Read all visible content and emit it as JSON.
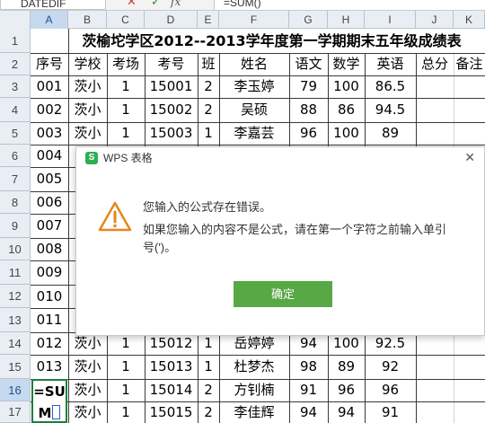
{
  "formula_bar": {
    "name_box": "DATEDIF",
    "cancel_glyph": "✕",
    "confirm_glyph": "✓",
    "fx_label": "fx",
    "formula": "=SUM()"
  },
  "columns": [
    "A",
    "B",
    "C",
    "D",
    "E",
    "F",
    "G",
    "H",
    "I",
    "J",
    "K"
  ],
  "active_column": "A",
  "active_row": "16",
  "sheet": {
    "title": "茨榆坨学区2012--2013学年度第一学期期末五年级成绩表",
    "headers": [
      "序号",
      "学校",
      "考场",
      "考号",
      "班",
      "姓名",
      "语文",
      "数学",
      "英语",
      "总分",
      "备注"
    ],
    "rows": [
      {
        "row": "3",
        "cells": [
          "001",
          "茨小",
          "1",
          "15001",
          "2",
          "李玉婷",
          "79",
          "100",
          "86.5",
          "",
          ""
        ]
      },
      {
        "row": "4",
        "cells": [
          "002",
          "茨小",
          "1",
          "15002",
          "2",
          "吴硕",
          "88",
          "86",
          "94.5",
          "",
          ""
        ]
      },
      {
        "row": "5",
        "cells": [
          "003",
          "茨小",
          "1",
          "15003",
          "1",
          "李嘉芸",
          "96",
          "100",
          "89",
          "",
          ""
        ]
      },
      {
        "row": "6",
        "cells": [
          "004",
          "",
          "",
          "",
          "",
          "",
          "",
          "",
          "",
          "",
          ""
        ]
      },
      {
        "row": "7",
        "cells": [
          "005",
          "",
          "",
          "",
          "",
          "",
          "",
          "",
          "",
          "",
          ""
        ]
      },
      {
        "row": "8",
        "cells": [
          "006",
          "",
          "",
          "",
          "",
          "",
          "",
          "",
          "",
          "",
          ""
        ]
      },
      {
        "row": "9",
        "cells": [
          "007",
          "",
          "",
          "",
          "",
          "",
          "",
          "",
          "",
          "",
          ""
        ]
      },
      {
        "row": "10",
        "cells": [
          "008",
          "",
          "",
          "",
          "",
          "",
          "",
          "",
          "",
          "",
          ""
        ]
      },
      {
        "row": "11",
        "cells": [
          "009",
          "",
          "",
          "",
          "",
          "",
          "",
          "",
          "",
          "",
          ""
        ]
      },
      {
        "row": "12",
        "cells": [
          "010",
          "",
          "",
          "",
          "",
          "",
          "",
          "",
          "",
          "",
          ""
        ]
      },
      {
        "row": "13",
        "cells": [
          "011",
          "",
          "",
          "",
          "",
          "",
          "",
          "",
          "",
          "",
          ""
        ]
      },
      {
        "row": "14",
        "cells": [
          "012",
          "茨小",
          "1",
          "15012",
          "1",
          "岳婷婷",
          "94",
          "100",
          "92.5",
          "",
          ""
        ]
      },
      {
        "row": "15",
        "cells": [
          "013",
          "茨小",
          "1",
          "15013",
          "1",
          "杜梦杰",
          "98",
          "89",
          "92",
          "",
          ""
        ]
      },
      {
        "row": "16",
        "cells": [
          "",
          "茨小",
          "1",
          "15014",
          "2",
          "方钊楠",
          "91",
          "96",
          "96",
          "",
          ""
        ]
      },
      {
        "row": "17",
        "cells": [
          "",
          "茨小",
          "1",
          "15015",
          "2",
          "李佳辉",
          "94",
          "94",
          "91",
          "",
          ""
        ]
      }
    ],
    "editing_text_line1": "=SU",
    "editing_text_line2": "M"
  },
  "dialog": {
    "logo_text": "S",
    "title": "WPS 表格",
    "close_glyph": "✕",
    "message_line1": "您输入的公式存在错误。",
    "message_line2": "如果您输入的内容不是公式，请在第一个字符之前输入单引号(')。",
    "ok_label": "确定",
    "accent_color": "#58a845",
    "warning_color": "#e6861c"
  }
}
